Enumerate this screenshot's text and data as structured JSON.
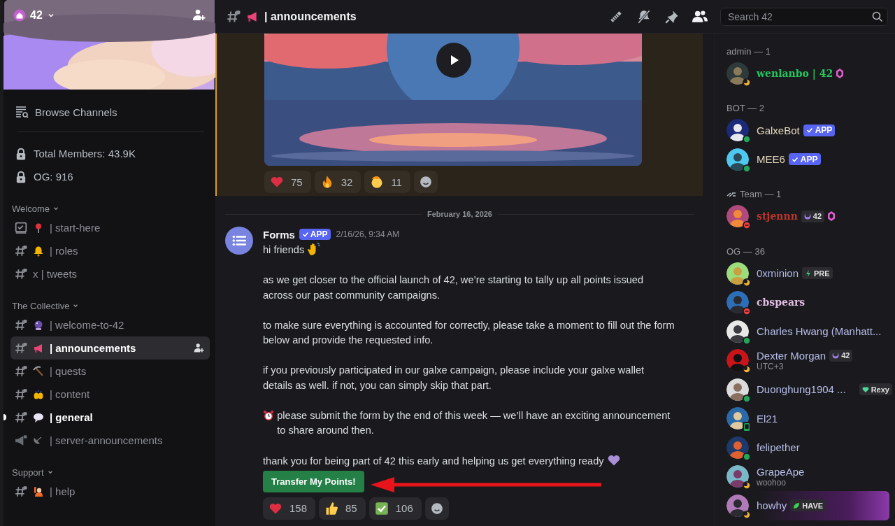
{
  "server": {
    "name": "42"
  },
  "sidebar": {
    "browse": "Browse Channels",
    "stats": [
      {
        "label": "Total Members: 43.9K"
      },
      {
        "label": "OG: 916"
      }
    ],
    "categories": [
      {
        "name": "Welcome",
        "channels": [
          {
            "kind": "rules",
            "emoji": {
              "kind": "pin"
            },
            "name": "| start-here",
            "selected": false,
            "unread": false
          },
          {
            "kind": "text",
            "emoji": {
              "kind": "bell"
            },
            "name": "| roles",
            "selected": false,
            "unread": false
          },
          {
            "kind": "text",
            "prefix": "x",
            "name": "| tweets",
            "selected": false,
            "unread": false
          }
        ]
      },
      {
        "name": "The Collective",
        "channels": [
          {
            "kind": "text",
            "emoji": {
              "kind": "ball"
            },
            "name": "| welcome-to-42",
            "selected": false,
            "unread": false
          },
          {
            "kind": "text",
            "emoji": {
              "kind": "megaphone"
            },
            "name": "| announcements",
            "selected": true,
            "unread": false
          },
          {
            "kind": "text",
            "emoji": {
              "kind": "pick"
            },
            "name": "| quests",
            "selected": false,
            "unread": false
          },
          {
            "kind": "text",
            "emoji": {
              "kind": "hands"
            },
            "name": "| content",
            "selected": false,
            "unread": false
          },
          {
            "kind": "text",
            "emoji": {
              "kind": "speech"
            },
            "name": "| general",
            "selected": false,
            "unread": true
          },
          {
            "kind": "announcement",
            "emoji": {
              "kind": "dish"
            },
            "name": "| server-announcements",
            "selected": false,
            "unread": false
          }
        ]
      },
      {
        "name": "Support",
        "channels": [
          {
            "kind": "text",
            "emoji": {
              "kind": "raising"
            },
            "name": "| help",
            "selected": false,
            "unread": false
          }
        ]
      }
    ]
  },
  "header": {
    "emoji": {
      "kind": "megaphone"
    },
    "channel": "| announcements"
  },
  "search": {
    "placeholder": "Search 42"
  },
  "earlier_message": {
    "reactions": [
      {
        "emoji": {
          "kind": "heart"
        },
        "count": "75"
      },
      {
        "emoji": {
          "kind": "fire"
        },
        "count": "32"
      },
      {
        "emoji": {
          "kind": "salute"
        },
        "count": "11"
      }
    ]
  },
  "date_divider": "February 16, 2026",
  "message": {
    "author": "Forms",
    "badge": "APP",
    "time": "2/16/26, 9:34 AM",
    "paragraphs": [
      {
        "text": "hi friends",
        "trailing_emoji": {
          "kind": "wave"
        }
      },
      {
        "text": "as we get closer to the official launch of 42, we’re starting to tally up all points issued across our past community campaigns."
      },
      {
        "text": "to make sure everything is accounted for correctly, please take a moment to fill out the form below and provide the requested info."
      },
      {
        "text": "if you previously participated in our galxe campaign, please include your galxe wallet details as well. if not, you can simply skip that part."
      },
      {
        "text": "please submit the form by the end of this week — we’ll have an exciting announcement to share around then.",
        "leading_emoji": {
          "kind": "alarm"
        }
      },
      {
        "text": "thank you for being part of 42 this early and helping us get everything ready",
        "trailing_emoji": {
          "kind": "purple_heart"
        }
      }
    ],
    "button": "Transfer My Points!",
    "reactions": [
      {
        "emoji": {
          "kind": "heart"
        },
        "count": "158"
      },
      {
        "emoji": {
          "kind": "thumbs"
        },
        "count": "85"
      },
      {
        "emoji": {
          "kind": "check"
        },
        "count": "106"
      }
    ]
  },
  "members": {
    "groups": [
      {
        "title": "admin — 1",
        "members": [
          {
            "name": "wenlanbo | 42",
            "color": "#23c55e",
            "styled": true,
            "status": {
              "kind": "idle"
            },
            "boosting": true
          }
        ]
      },
      {
        "title": "BOT — 2",
        "members": [
          {
            "name": "GalxeBot",
            "color": "#e6d6bc",
            "status": {
              "kind": "online"
            },
            "tag": {
              "kind": "app",
              "text": "APP"
            }
          },
          {
            "name": "MEE6",
            "color": "#e6d6bc",
            "status": {
              "kind": "online"
            },
            "tag": {
              "kind": "app",
              "text": "APP"
            }
          }
        ]
      },
      {
        "title": "Team — 1",
        "team_icon": true,
        "members": [
          {
            "name": "stjennn",
            "color": "#b8362c",
            "styled": true,
            "status": {
              "kind": "dnd"
            },
            "boosting": true,
            "tag": {
              "kind": "guild",
              "text": "42"
            }
          }
        ]
      },
      {
        "title": "OG — 36",
        "members": [
          {
            "name": "0xminion",
            "color": "#aeb8ea",
            "status": {
              "kind": "idle"
            },
            "tag": {
              "kind": "pre",
              "text": "PRE"
            }
          },
          {
            "name": "cbspears",
            "color": "#e3bde3",
            "styled": true,
            "status": {
              "kind": "dnd"
            }
          },
          {
            "name": "Charles Hwang (Manhatt...",
            "color": "#b6bde8",
            "status": {
              "kind": "online"
            }
          },
          {
            "name": "Dexter Morgan",
            "color": "#b6bde8",
            "status": {
              "kind": "idle"
            },
            "subtitle": "UTC+3",
            "tag": {
              "kind": "guild",
              "text": "42"
            }
          },
          {
            "name": "Duonghung1904 ...",
            "color": "#b6bde8",
            "status": {
              "kind": "online"
            },
            "tag": {
              "kind": "rexy",
              "text": "Rexy"
            }
          },
          {
            "name": "El21",
            "color": "#b6bde8",
            "status": {
              "kind": "mobile"
            }
          },
          {
            "name": "felipether",
            "color": "#b6bde8",
            "status": {
              "kind": "online"
            }
          },
          {
            "name": "GrapeApe",
            "color": "#b6bde8",
            "status": {
              "kind": "idle"
            },
            "subtitle": "woohoo"
          },
          {
            "name": "howhy",
            "color": "#b6bde8",
            "status": {
              "kind": "idle"
            },
            "nameplate": true,
            "tag": {
              "kind": "have",
              "text": "HAVE"
            }
          }
        ]
      }
    ]
  }
}
